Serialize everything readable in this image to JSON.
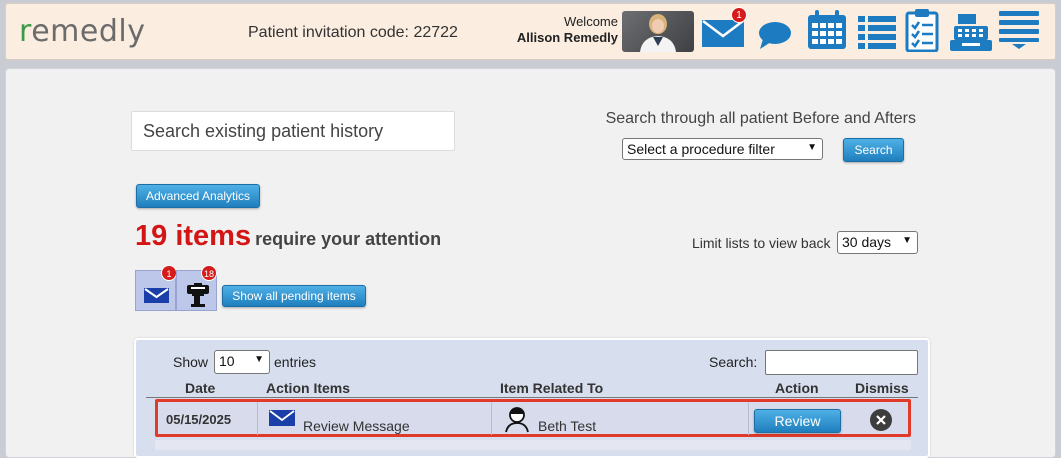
{
  "header": {
    "logo": "remedly",
    "invite_text": "Patient invitation code: 22722",
    "welcome_label": "Welcome",
    "user_name": "Allison Remedly",
    "messages_badge": "1",
    "icons": [
      "mail-icon",
      "chat-icon",
      "calendar-icon",
      "list-icon",
      "clipboard-icon",
      "register-icon",
      "menu-icon"
    ]
  },
  "search": {
    "history_placeholder": "Search existing patient history",
    "before_afters_label": "Search through all patient Before and Afters",
    "procedure_filter": "Select a procedure filter",
    "search_button": "Search"
  },
  "analytics_button": "Advanced Analytics",
  "attention": {
    "count": "19 items",
    "text": "require your attention",
    "limit_label": "Limit lists to view back",
    "limit_value": "30 days"
  },
  "pending": {
    "mail_badge": "1",
    "task_badge": "18",
    "show_all_button": "Show all pending items"
  },
  "table": {
    "show_label": "Show",
    "entries_value": "10",
    "entries_label": "entries",
    "search_label": "Search:",
    "columns": [
      "Date",
      "Action Items",
      "Item Related To",
      "Action",
      "Dismiss"
    ],
    "rows": [
      {
        "date": "05/15/2025",
        "action_item": "Review Message",
        "related_to": "Beth Test",
        "action_button": "Review"
      }
    ]
  },
  "colors": {
    "header_bg": "#fbeee0",
    "accent_blue": "#1f7fbe",
    "alert_red": "#d31515",
    "logo_green": "#3c9a47"
  }
}
